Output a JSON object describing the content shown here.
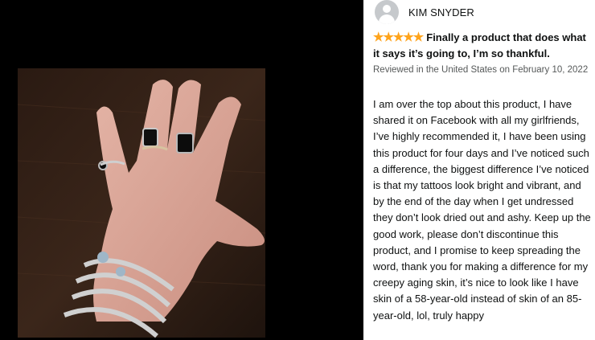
{
  "photo": {
    "description_icon": "photo-hand-with-rings"
  },
  "review": {
    "reviewer_name": "KIM SNYDER",
    "rating_stars": "★★★★★",
    "rating_value": 5,
    "rating_max": 5,
    "title": "Finally a product that does what it says it’s going to, I’m so thankful.",
    "meta": "Reviewed in the United States on February 10, 2022",
    "body": "I am over the top about this product, I have shared it on Facebook with all my girlfriends, I’ve highly recommended it, I have been using this product for four days and I’ve noticed such a difference, the biggest difference I’ve noticed is that my tattoos look bright and vibrant, and by the end of the day when I get undressed they don’t look dried out and ashy. Keep up the good work, please don’t discontinue this product, and I promise to keep spreading the word, thank you for making a difference for my creepy aging skin, it’s nice to look like I have skin of a 58-year-old instead of skin of an 85-year-old, lol, truly happy"
  },
  "colors": {
    "star": "#ffa41c",
    "text": "#0f1111",
    "muted": "#565959",
    "avatar": "#c6c9cc"
  }
}
